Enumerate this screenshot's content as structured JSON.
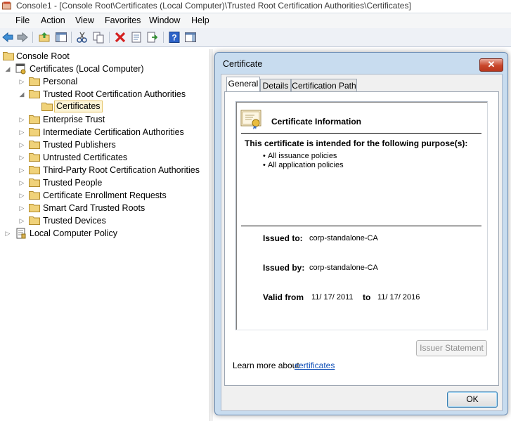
{
  "window": {
    "title": "Console1 - [Console Root\\Certificates (Local Computer)\\Trusted Root Certification Authorities\\Certificates]"
  },
  "menu": [
    "File",
    "Action",
    "View",
    "Favorites",
    "Window",
    "Help"
  ],
  "toolbar": {
    "icons": [
      "back-arrow-icon",
      "forward-arrow-icon",
      "up-folder-icon",
      "show-hide-tree-icon",
      "cut-icon",
      "copy-icon",
      "delete-icon",
      "properties-icon",
      "export-list-icon",
      "help-icon",
      "show-hide-action-pane-icon"
    ]
  },
  "tree": {
    "root": "Console Root",
    "certificates": "Certificates (Local Computer)",
    "items": [
      "Personal",
      "Trusted Root Certification Authorities",
      "Certificates",
      "Enterprise Trust",
      "Intermediate Certification Authorities",
      "Trusted Publishers",
      "Untrusted Certificates",
      "Third-Party Root Certification Authorities",
      "Trusted People",
      "Certificate Enrollment Requests",
      "Smart Card Trusted Roots",
      "Trusted Devices"
    ],
    "policy": "Local Computer Policy"
  },
  "dialog": {
    "title": "Certificate",
    "close": "✕",
    "tabs": [
      "General",
      "Details",
      "Certification Path"
    ],
    "info_heading": "Certificate Information",
    "purpose_heading": "This certificate is intended for the following purpose(s):",
    "purposes": [
      "All issuance policies",
      "All application policies"
    ],
    "issued_to_label": "Issued to:",
    "issued_to": "corp-standalone-CA",
    "issued_by_label": "Issued by:",
    "issued_by": "corp-standalone-CA",
    "valid_from_label": "Valid from",
    "valid_from": "11/ 17/ 2011",
    "valid_to_label": "to",
    "valid_to": "11/ 17/ 2016",
    "issuer_statement": "Issuer Statement",
    "learn_more": "Learn more about",
    "learn_more_link": "certificates",
    "ok": "OK"
  },
  "colors": {
    "folder": "#f0d27a",
    "accent": "#3c7fb1",
    "close_red": "#c9462b",
    "link": "#0b4cb6"
  }
}
